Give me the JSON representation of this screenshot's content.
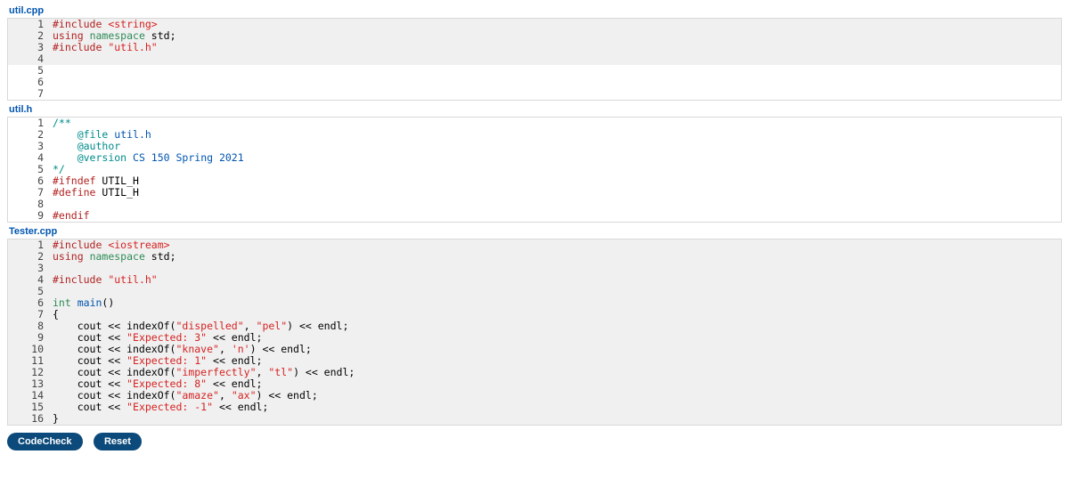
{
  "files": [
    {
      "label": "util.cpp",
      "blocks": [
        {
          "readonly": true,
          "lines": [
            {
              "n": "1",
              "tokens": [
                {
                  "c": "kw-red",
                  "t": "#include"
                },
                {
                  "t": " "
                },
                {
                  "c": "inc-red",
                  "t": "<string>"
                }
              ]
            },
            {
              "n": "2",
              "tokens": [
                {
                  "c": "kw-red",
                  "t": "using"
                },
                {
                  "t": " "
                },
                {
                  "c": "kw-green",
                  "t": "namespace"
                },
                {
                  "t": " std;"
                }
              ]
            },
            {
              "n": "3",
              "tokens": [
                {
                  "c": "kw-red",
                  "t": "#include"
                },
                {
                  "t": " "
                },
                {
                  "c": "str",
                  "t": "\"util.h\""
                }
              ]
            },
            {
              "n": "4",
              "tokens": []
            }
          ]
        },
        {
          "readonly": false,
          "lines": [
            {
              "n": "5",
              "tokens": []
            },
            {
              "n": "6",
              "tokens": []
            },
            {
              "n": "7",
              "tokens": []
            }
          ]
        }
      ]
    },
    {
      "label": "util.h",
      "blocks": [
        {
          "readonly": false,
          "lines": [
            {
              "n": "1",
              "tokens": [
                {
                  "c": "kw-teal",
                  "t": "/**"
                }
              ]
            },
            {
              "n": "2",
              "tokens": [
                {
                  "t": "    "
                },
                {
                  "c": "kw-teal",
                  "t": "@file"
                },
                {
                  "t": " "
                },
                {
                  "c": "kw-blue",
                  "t": "util.h"
                }
              ]
            },
            {
              "n": "3",
              "tokens": [
                {
                  "t": "    "
                },
                {
                  "c": "kw-teal",
                  "t": "@author"
                }
              ]
            },
            {
              "n": "4",
              "tokens": [
                {
                  "t": "    "
                },
                {
                  "c": "kw-teal",
                  "t": "@version"
                },
                {
                  "t": " "
                },
                {
                  "c": "kw-blue",
                  "t": "CS 150 Spring 2021"
                }
              ]
            },
            {
              "n": "5",
              "tokens": [
                {
                  "c": "kw-teal",
                  "t": "*/"
                }
              ]
            },
            {
              "n": "6",
              "tokens": [
                {
                  "c": "kw-red",
                  "t": "#ifndef"
                },
                {
                  "t": " UTIL_H"
                }
              ]
            },
            {
              "n": "7",
              "tokens": [
                {
                  "c": "kw-red",
                  "t": "#define"
                },
                {
                  "t": " UTIL_H"
                }
              ]
            },
            {
              "n": "8",
              "tokens": []
            },
            {
              "n": "9",
              "tokens": [
                {
                  "c": "kw-red",
                  "t": "#endif"
                }
              ]
            }
          ]
        }
      ]
    },
    {
      "label": "Tester.cpp",
      "blocks": [
        {
          "readonly": true,
          "lines": [
            {
              "n": "1",
              "tokens": [
                {
                  "c": "kw-red",
                  "t": "#include"
                },
                {
                  "t": " "
                },
                {
                  "c": "inc-red",
                  "t": "<iostream>"
                }
              ]
            },
            {
              "n": "2",
              "tokens": [
                {
                  "c": "kw-red",
                  "t": "using"
                },
                {
                  "t": " "
                },
                {
                  "c": "kw-green",
                  "t": "namespace"
                },
                {
                  "t": " std;"
                }
              ]
            },
            {
              "n": "3",
              "tokens": []
            },
            {
              "n": "4",
              "tokens": [
                {
                  "c": "kw-red",
                  "t": "#include"
                },
                {
                  "t": " "
                },
                {
                  "c": "str",
                  "t": "\"util.h\""
                }
              ]
            },
            {
              "n": "5",
              "tokens": []
            },
            {
              "n": "6",
              "tokens": [
                {
                  "c": "kw-green",
                  "t": "int"
                },
                {
                  "t": " "
                },
                {
                  "c": "kw-blue",
                  "t": "main"
                },
                {
                  "t": "()"
                }
              ]
            },
            {
              "n": "7",
              "tokens": [
                {
                  "t": "{"
                }
              ]
            },
            {
              "n": "8",
              "tokens": [
                {
                  "t": "    cout << indexOf("
                },
                {
                  "c": "str",
                  "t": "\"dispelled\""
                },
                {
                  "t": ", "
                },
                {
                  "c": "str",
                  "t": "\"pel\""
                },
                {
                  "t": ") << endl;"
                }
              ]
            },
            {
              "n": "9",
              "tokens": [
                {
                  "t": "    cout << "
                },
                {
                  "c": "str",
                  "t": "\"Expected: 3\""
                },
                {
                  "t": " << endl;"
                }
              ]
            },
            {
              "n": "10",
              "tokens": [
                {
                  "t": "    cout << indexOf("
                },
                {
                  "c": "str",
                  "t": "\"knave\""
                },
                {
                  "t": ", "
                },
                {
                  "c": "chr",
                  "t": "'n'"
                },
                {
                  "t": ") << endl;"
                }
              ]
            },
            {
              "n": "11",
              "tokens": [
                {
                  "t": "    cout << "
                },
                {
                  "c": "str",
                  "t": "\"Expected: 1\""
                },
                {
                  "t": " << endl;"
                }
              ]
            },
            {
              "n": "12",
              "tokens": [
                {
                  "t": "    cout << indexOf("
                },
                {
                  "c": "str",
                  "t": "\"imperfectly\""
                },
                {
                  "t": ", "
                },
                {
                  "c": "str",
                  "t": "\"tl\""
                },
                {
                  "t": ") << endl;"
                }
              ]
            },
            {
              "n": "13",
              "tokens": [
                {
                  "t": "    cout << "
                },
                {
                  "c": "str",
                  "t": "\"Expected: 8\""
                },
                {
                  "t": " << endl;"
                }
              ]
            },
            {
              "n": "14",
              "tokens": [
                {
                  "t": "    cout << indexOf("
                },
                {
                  "c": "str",
                  "t": "\"amaze\""
                },
                {
                  "t": ", "
                },
                {
                  "c": "str",
                  "t": "\"ax\""
                },
                {
                  "t": ") << endl;"
                }
              ]
            },
            {
              "n": "15",
              "tokens": [
                {
                  "t": "    cout << "
                },
                {
                  "c": "str",
                  "t": "\"Expected: -1\""
                },
                {
                  "t": " << endl;"
                }
              ]
            },
            {
              "n": "16",
              "tokens": [
                {
                  "t": "}"
                }
              ]
            }
          ]
        }
      ]
    }
  ],
  "buttons": {
    "codecheck": "CodeCheck",
    "reset": "Reset"
  }
}
